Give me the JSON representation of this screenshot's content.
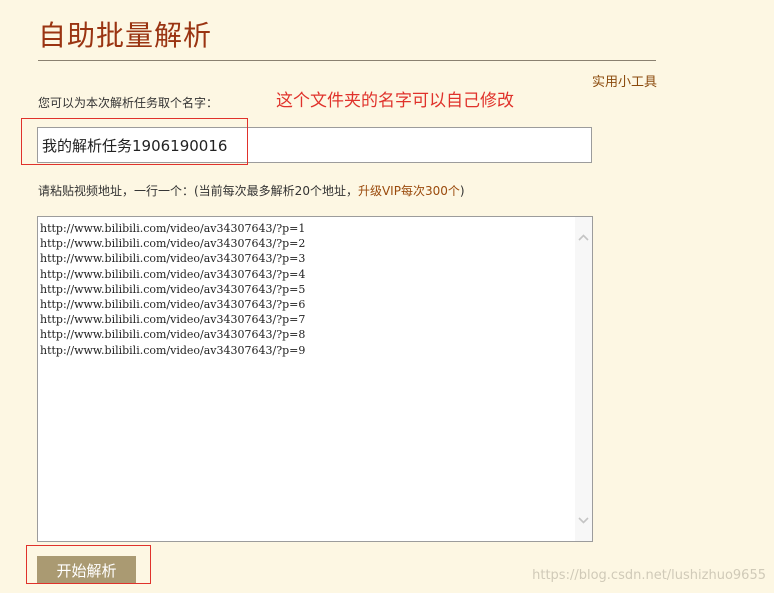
{
  "page": {
    "title": "自助批量解析",
    "tools_link": "实用小工具"
  },
  "task_name": {
    "label": "您可以为本次解析任务取个名字：",
    "value": "我的解析任务1906190016",
    "annotation": "这个文件夹的名字可以自己修改"
  },
  "urls": {
    "label_prefix": "请粘贴视频地址，一行一个：(当前每次最多解析20个地址，",
    "label_vip": "升级VIP每次300个",
    "label_suffix": ")",
    "lines": [
      "http://www.bilibili.com/video/av34307643/?p=1",
      "http://www.bilibili.com/video/av34307643/?p=2",
      "http://www.bilibili.com/video/av34307643/?p=3",
      "http://www.bilibili.com/video/av34307643/?p=4",
      "http://www.bilibili.com/video/av34307643/?p=5",
      "http://www.bilibili.com/video/av34307643/?p=6",
      "http://www.bilibili.com/video/av34307643/?p=7",
      "http://www.bilibili.com/video/av34307643/?p=8",
      "http://www.bilibili.com/video/av34307643/?p=9"
    ]
  },
  "actions": {
    "start_label": "开始解析"
  },
  "watermark": "https://blog.csdn.net/lushizhuo9655",
  "colors": {
    "accent_title": "#9a3412",
    "annotation_red": "#e0322b",
    "button_bg": "#aa9a72",
    "page_bg": "#fdf7e3"
  }
}
